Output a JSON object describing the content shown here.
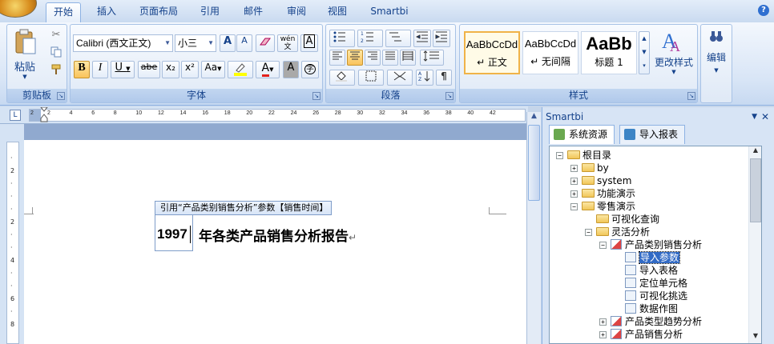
{
  "tabs": [
    {
      "label": "开始",
      "active": true
    },
    {
      "label": "插入"
    },
    {
      "label": "页面布局"
    },
    {
      "label": "引用"
    },
    {
      "label": "邮件"
    },
    {
      "label": "审阅"
    },
    {
      "label": "视图"
    },
    {
      "label": "Smartbi"
    }
  ],
  "help_label": "?",
  "ribbon": {
    "clipboard": {
      "paste_label": "粘贴",
      "group_label": "剪贴板"
    },
    "font": {
      "font_name": "Calibri (西文正文)",
      "font_size": "小三",
      "group_label": "字体",
      "bold": "B",
      "italic": "I",
      "underline": "U",
      "strike": "abe",
      "subscript": "x₂",
      "superscript": "x²",
      "change_case": "Aa",
      "grow": "A",
      "shrink": "A",
      "wen": "wén",
      "wen_char": "文",
      "char_border": "A",
      "char_shading": "A",
      "enclose": "字"
    },
    "paragraph": {
      "group_label": "段落"
    },
    "styles": {
      "group_label": "样式",
      "items": [
        {
          "preview": "AaBbCcDd",
          "name": "↵ 正文",
          "active": true
        },
        {
          "preview": "AaBbCcDd",
          "name": "↵ 无间隔"
        },
        {
          "preview": "AaBb",
          "name": "标题 1"
        }
      ],
      "change_label": "更改样式"
    },
    "editing": {
      "label": "编辑"
    }
  },
  "ruler": {
    "numbers": [
      "2",
      "2",
      "4",
      "6",
      "8",
      "10",
      "12",
      "14",
      "16",
      "18",
      "20",
      "22",
      "24",
      "26",
      "28",
      "30",
      "32",
      "34",
      "36",
      "38",
      "40",
      "42"
    ]
  },
  "document": {
    "field_tag": "引用“产品类别销售分析”参数【销售时间】",
    "field_value": "1997",
    "heading_rest": "年各类产品销售分析报告",
    "para_mark": "↵"
  },
  "panel": {
    "title": "Smartbi",
    "tabs": [
      {
        "label": "系统资源",
        "active": true
      },
      {
        "label": "导入报表"
      }
    ],
    "tree": [
      {
        "label": "根目录",
        "type": "folder",
        "exp": "−"
      },
      {
        "label": "by",
        "type": "folder",
        "exp": "+"
      },
      {
        "label": "system",
        "type": "folder",
        "exp": "+"
      },
      {
        "label": "功能演示",
        "type": "folder",
        "exp": "+"
      },
      {
        "label": "零售演示",
        "type": "folder",
        "exp": "−"
      },
      {
        "label": "可视化查询",
        "type": "folder"
      },
      {
        "label": "灵活分析",
        "type": "folder",
        "exp": "−"
      },
      {
        "label": "产品类别销售分析",
        "type": "report",
        "exp": "−"
      },
      {
        "label": "导入参数",
        "type": "leaf",
        "selected": true
      },
      {
        "label": "导入表格",
        "type": "leaf"
      },
      {
        "label": "定位单元格",
        "type": "leaf"
      },
      {
        "label": "可视化挑选",
        "type": "leaf"
      },
      {
        "label": "数据作图",
        "type": "leaf"
      },
      {
        "label": "产品类型趋势分析",
        "type": "report",
        "exp": "+"
      },
      {
        "label": "产品销售分析",
        "type": "report",
        "exp": "+"
      }
    ]
  }
}
